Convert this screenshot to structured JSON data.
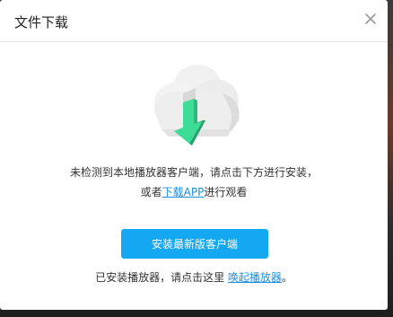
{
  "dialog": {
    "title": "文件下载",
    "close_icon": "close-icon",
    "illustration_icon": "cloud-download-icon",
    "message_line1": "未检测到本地播放器客户端，请点击下方进行安装，",
    "message_line2_prefix": "或者",
    "download_app_link": "下载APP",
    "message_line2_suffix": "进行观看",
    "install_button": "安装最新版客户端",
    "installed_prefix": "已安装播放器，请点击这里",
    "launch_link": "唤起播放器",
    "installed_suffix": "。",
    "colors": {
      "accent": "#14a8f2",
      "link": "#1d8fe0",
      "arrow": "#3ddc97"
    }
  }
}
